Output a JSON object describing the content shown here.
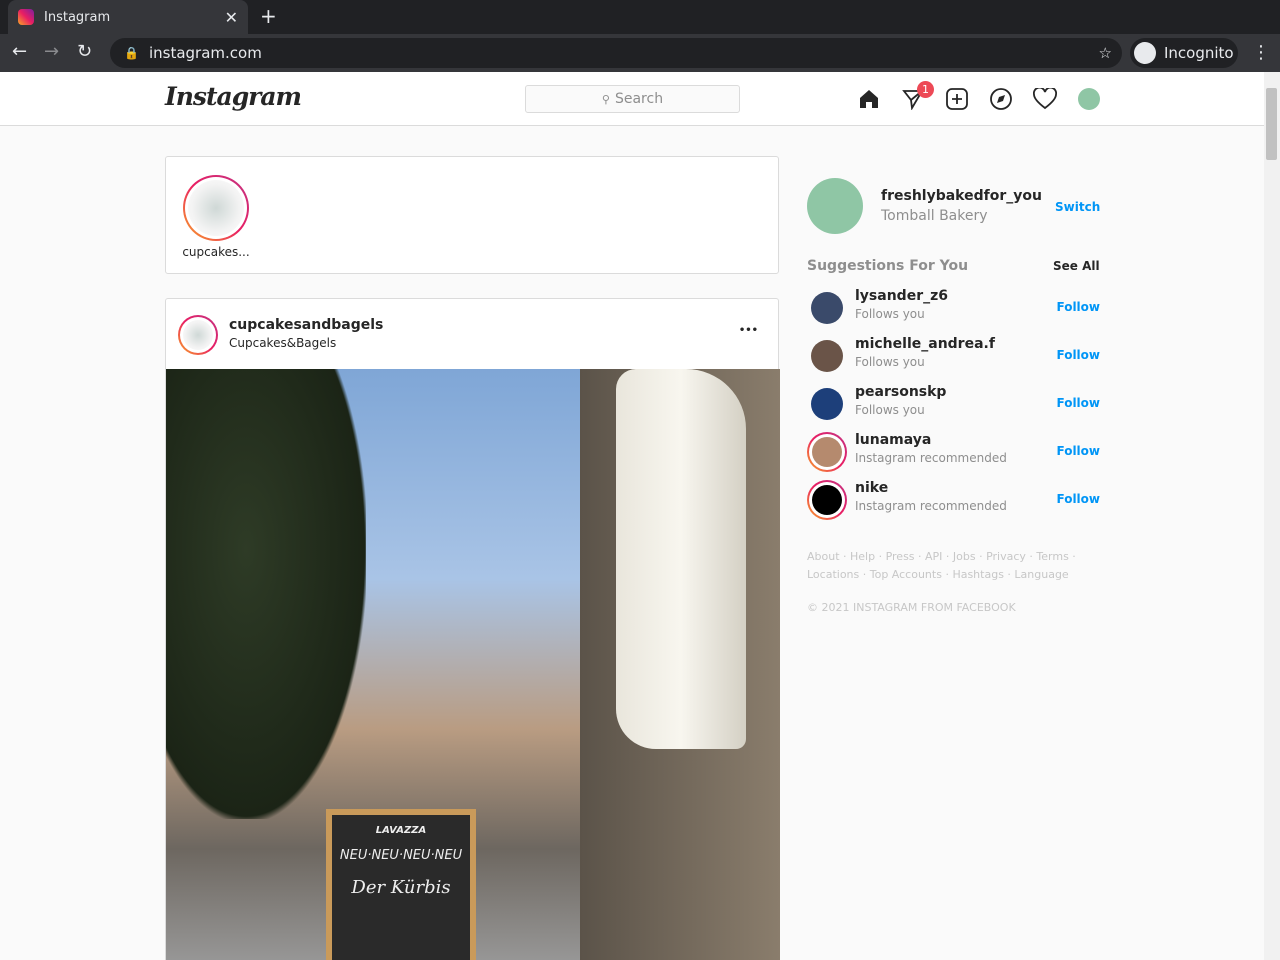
{
  "browser": {
    "tab_title": "Instagram",
    "url": "instagram.com",
    "incognito": "Incognito"
  },
  "header": {
    "logo": "Instagram",
    "search_placeholder": "Search",
    "dm_badge": "1"
  },
  "stories": [
    {
      "name": "cupcakes..."
    }
  ],
  "post": {
    "username": "cupcakesandbagels",
    "subtitle": "Cupcakes&Bagels",
    "more": "•••",
    "board_brand": "LAVAZZA",
    "board_text": "NEU·NEU·NEU·NEU",
    "board_text2": "Der Kürbis"
  },
  "profile": {
    "username": "freshlybakedfor_you",
    "name": "Tomball Bakery",
    "switch": "Switch"
  },
  "suggestions": {
    "title": "Suggestions For You",
    "see_all": "See All",
    "follow": "Follow",
    "items": [
      {
        "name": "lysander_z6",
        "sub": "Follows you"
      },
      {
        "name": "michelle_andrea.f",
        "sub": "Follows you"
      },
      {
        "name": "pearsonskp",
        "sub": "Follows you"
      },
      {
        "name": "lunamaya",
        "sub": "Instagram recommended"
      },
      {
        "name": "nike",
        "sub": "Instagram recommended"
      }
    ]
  },
  "footer": {
    "links1": "About · Help · Press · API · Jobs · Privacy · Terms ·",
    "links2": "Locations · Top Accounts · Hashtags · Language",
    "copyright": "© 2021 INSTAGRAM FROM FACEBOOK"
  }
}
